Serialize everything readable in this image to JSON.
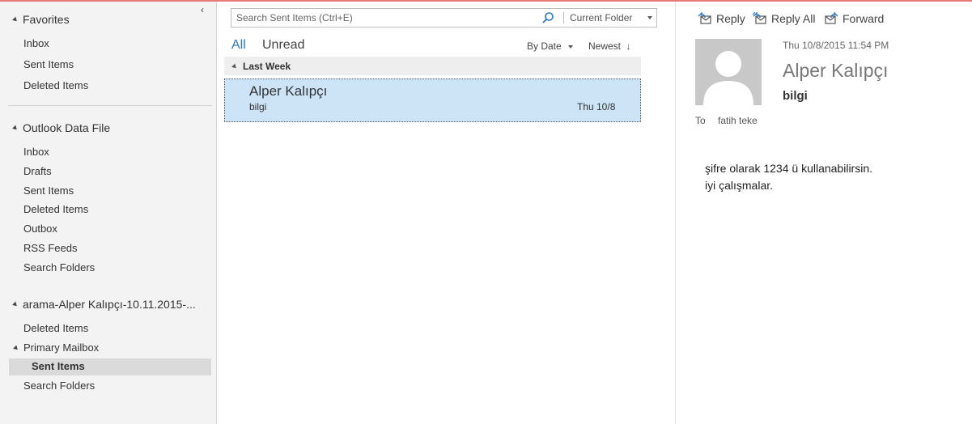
{
  "colors": {
    "accent": "#2b78c5",
    "selected_row": "#cde4f7",
    "pane_bg": "#f3f3f3",
    "top_line": "#e87a7a"
  },
  "folder_pane": {
    "collapse_icon": "chevron-left-icon",
    "favorites": {
      "title": "Favorites",
      "items": [
        "Inbox",
        "Sent Items",
        "Deleted Items"
      ]
    },
    "data_file": {
      "title": "Outlook Data File",
      "items": [
        "Inbox",
        "Drafts",
        "Sent Items",
        "Deleted Items",
        "Outbox",
        "RSS Feeds",
        "Search Folders"
      ]
    },
    "archive": {
      "title": "arama-Alper Kalıpçı-10.11.2015-...",
      "items": [
        "Deleted Items",
        "Primary Mailbox",
        "Sent Items",
        "Search Folders"
      ]
    }
  },
  "message_list": {
    "search": {
      "placeholder": "Search Sent Items (Ctrl+E)",
      "icon": "search-icon",
      "scope": "Current Folder"
    },
    "tabs": {
      "all": "All",
      "unread": "Unread"
    },
    "sort": {
      "by": "By Date",
      "order": "Newest"
    },
    "groups": [
      {
        "label": "Last Week",
        "messages": [
          {
            "from": "Alper Kalıpçı",
            "subject": "bilgi",
            "date": "Thu 10/8"
          }
        ]
      }
    ]
  },
  "reading_pane": {
    "actions": {
      "reply": "Reply",
      "reply_all": "Reply All",
      "forward": "Forward"
    },
    "timestamp": "Thu 10/8/2015 11:54 PM",
    "sender": "Alper Kalıpçı",
    "subject": "bilgi",
    "to_label": "To",
    "to_name": "fatih teke",
    "body": [
      "şifre olarak 1234 ü kullanabilirsin.",
      "iyi çalışmalar."
    ]
  }
}
